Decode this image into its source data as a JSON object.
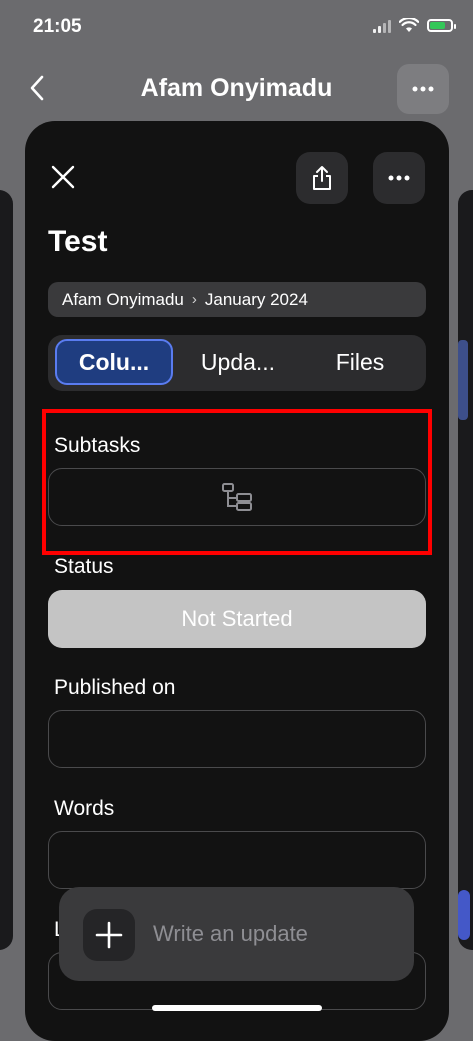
{
  "status_bar": {
    "time": "21:05"
  },
  "nav": {
    "title": "Afam Onyimadu"
  },
  "item": {
    "title": "Test",
    "breadcrumb": {
      "board": "Afam Onyimadu",
      "group": "January 2024"
    }
  },
  "tabs": [
    {
      "label": "Colu...",
      "active": true
    },
    {
      "label": "Upda...",
      "active": false
    },
    {
      "label": "Files",
      "active": false
    }
  ],
  "fields": {
    "subtasks": {
      "label": "Subtasks",
      "icon": "subtasks-tree-icon"
    },
    "status": {
      "label": "Status",
      "value": "Not Started",
      "color": "#c4c4c4"
    },
    "published_on": {
      "label": "Published on",
      "value": ""
    },
    "words": {
      "label": "Words",
      "value": ""
    },
    "partial_label": "L"
  },
  "composer": {
    "placeholder": "Write an update"
  },
  "colors": {
    "accent": "#1f3d80",
    "accent_border": "#5a7cf0",
    "highlight": "#ff0000",
    "sheet_bg": "#121212"
  }
}
